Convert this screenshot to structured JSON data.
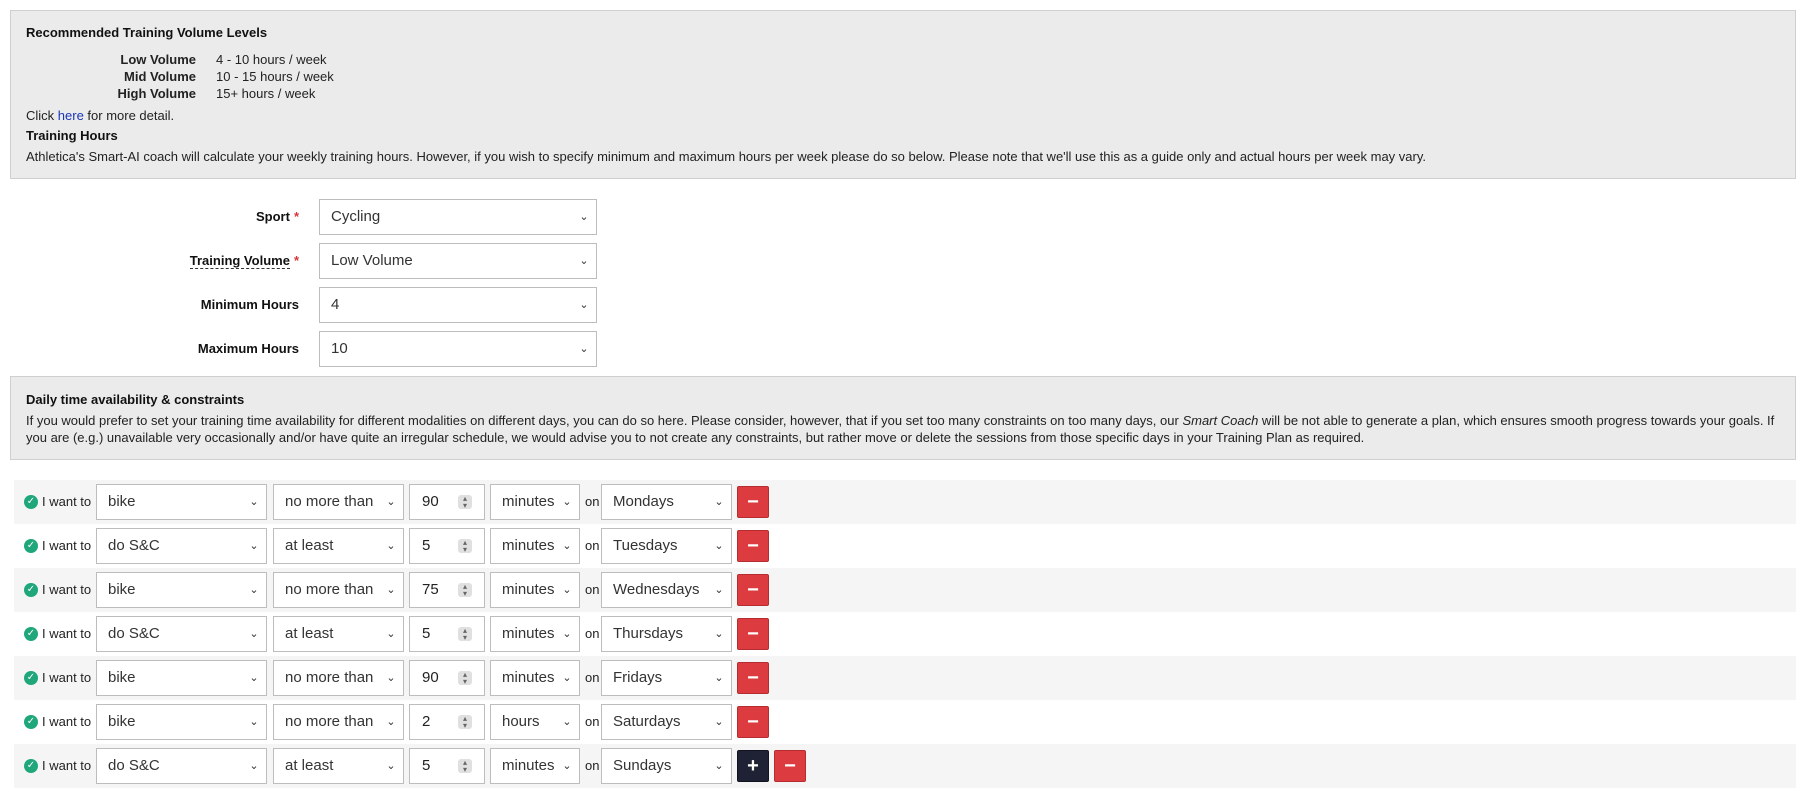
{
  "recommended": {
    "title": "Recommended Training Volume Levels",
    "levels": [
      {
        "label": "Low Volume",
        "value": "4 - 10 hours / week"
      },
      {
        "label": "Mid Volume",
        "value": "10 - 15 hours / week"
      },
      {
        "label": "High Volume",
        "value": "15+ hours / week"
      }
    ],
    "click_prefix": "Click ",
    "click_link": "here",
    "click_suffix": " for more detail.",
    "hours_title": "Training Hours",
    "hours_text": "Athletica's Smart-AI coach will calculate your weekly training hours. However, if you wish to specify minimum and maximum hours per week please do so below. Please note that we'll use this as a guide only and actual hours per week may vary."
  },
  "form": {
    "sport_label": "Sport",
    "sport_value": "Cycling",
    "volume_label": "Training Volume",
    "volume_value": "Low Volume",
    "min_label": "Minimum Hours",
    "min_value": "4",
    "max_label": "Maximum Hours",
    "max_value": "10",
    "required_mark": "*"
  },
  "availability": {
    "title": "Daily time availability & constraints",
    "text_1": "If you would prefer to set your training time availability for different modalities on different days, you can do so here. Please consider, however, that if you set too many constraints on too many days, our ",
    "text_em": "Smart Coach",
    "text_2": " will be not able to generate a plan, which ensures smooth progress towards your goals. If you are (e.g.) unavailable very occasionally and/or have quite an irregular schedule, we would advise you to not create any constraints, but rather move or delete the sessions from those specific days in your Training Plan as required."
  },
  "constraints": {
    "prefix": "I want to",
    "on": "on",
    "remove_icon": "−",
    "add_icon": "+",
    "rows": [
      {
        "activity": "bike",
        "comparison": "no more than",
        "amount": "90",
        "unit": "minutes",
        "day": "Mondays"
      },
      {
        "activity": "do S&C",
        "comparison": "at least",
        "amount": "5",
        "unit": "minutes",
        "day": "Tuesdays"
      },
      {
        "activity": "bike",
        "comparison": "no more than",
        "amount": "75",
        "unit": "minutes",
        "day": "Wednesdays"
      },
      {
        "activity": "do S&C",
        "comparison": "at least",
        "amount": "5",
        "unit": "minutes",
        "day": "Thursdays"
      },
      {
        "activity": "bike",
        "comparison": "no more than",
        "amount": "90",
        "unit": "minutes",
        "day": "Fridays"
      },
      {
        "activity": "bike",
        "comparison": "no more than",
        "amount": "2",
        "unit": "hours",
        "day": "Saturdays"
      },
      {
        "activity": "do S&C",
        "comparison": "at least",
        "amount": "5",
        "unit": "minutes",
        "day": "Sundays"
      }
    ]
  },
  "colors": {
    "remove": "#dc3c40",
    "add": "#1f2235",
    "check": "#1fa77b",
    "link": "#1a35b5"
  }
}
